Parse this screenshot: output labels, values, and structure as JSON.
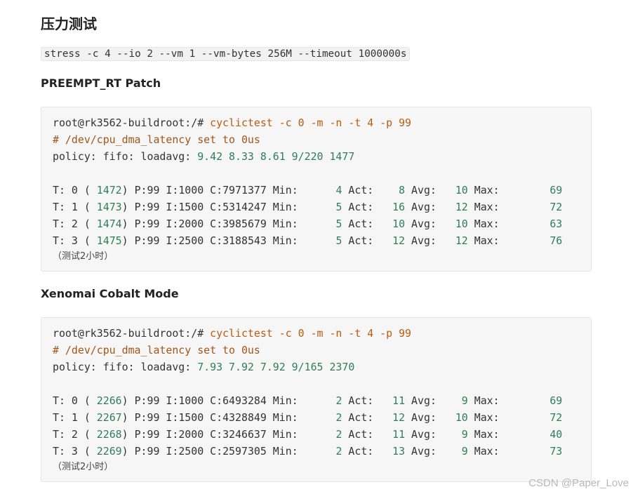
{
  "title": "压力测试",
  "stress_cmd": "stress -c 4 --io 2 --vm 1 --vm-bytes 256M --timeout 1000000s",
  "sections": [
    {
      "heading": "PREEMPT_RT Patch",
      "prompt": "root@rk3562-buildroot:/# ",
      "command": "cyclictest -c 0 -m -n -t 4 -p 99",
      "comment": "# /dev/cpu_dma_latency set to 0us",
      "policy_label": "policy: fifo: loadavg: ",
      "loadavg": "9.42 8.33 8.61 9/220 1477",
      "rows": [
        {
          "label": "T: 0 ( ",
          "pid": "1472",
          "mid": ") P:99 I:1000 C:7971377 Min:      ",
          "min": "4",
          "act": "8",
          "avg": "10",
          "max": "69"
        },
        {
          "label": "T: 1 ( ",
          "pid": "1473",
          "mid": ") P:99 I:1500 C:5314247 Min:      ",
          "min": "5",
          "act": "16",
          "avg": "12",
          "max": "72"
        },
        {
          "label": "T: 2 ( ",
          "pid": "1474",
          "mid": ") P:99 I:2000 C:3985679 Min:      ",
          "min": "5",
          "act": "10",
          "avg": "10",
          "max": "63"
        },
        {
          "label": "T: 3 ( ",
          "pid": "1475",
          "mid": ") P:99 I:2500 C:3188543 Min:      ",
          "min": "5",
          "act": "12",
          "avg": "12",
          "max": "76"
        }
      ],
      "note": "（测试2小时）"
    },
    {
      "heading": "Xenomai Cobalt Mode",
      "prompt": "root@rk3562-buildroot:/# ",
      "command": "cyclictest -c 0 -m -n -t 4 -p 99",
      "comment": "# /dev/cpu_dma_latency set to 0us",
      "policy_label": "policy: fifo: loadavg: ",
      "loadavg": "7.93 7.92 7.92 9/165 2370",
      "rows": [
        {
          "label": "T: 0 ( ",
          "pid": "2266",
          "mid": ") P:99 I:1000 C:6493284 Min:      ",
          "min": "2",
          "act": "11",
          "avg": "9",
          "max": "69"
        },
        {
          "label": "T: 1 ( ",
          "pid": "2267",
          "mid": ") P:99 I:1500 C:4328849 Min:      ",
          "min": "2",
          "act": "12",
          "avg": "10",
          "max": "72"
        },
        {
          "label": "T: 2 ( ",
          "pid": "2268",
          "mid": ") P:99 I:2000 C:3246637 Min:      ",
          "min": "2",
          "act": "11",
          "avg": "9",
          "max": "40"
        },
        {
          "label": "T: 3 ( ",
          "pid": "2269",
          "mid": ") P:99 I:2500 C:2597305 Min:      ",
          "min": "2",
          "act": "13",
          "avg": "9",
          "max": "73"
        }
      ],
      "note": "（测试2小时）"
    }
  ],
  "labels": {
    "act": " Act: ",
    "avg": " Avg: ",
    "max": " Max: "
  },
  "watermark": "CSDN @Paper_Love"
}
